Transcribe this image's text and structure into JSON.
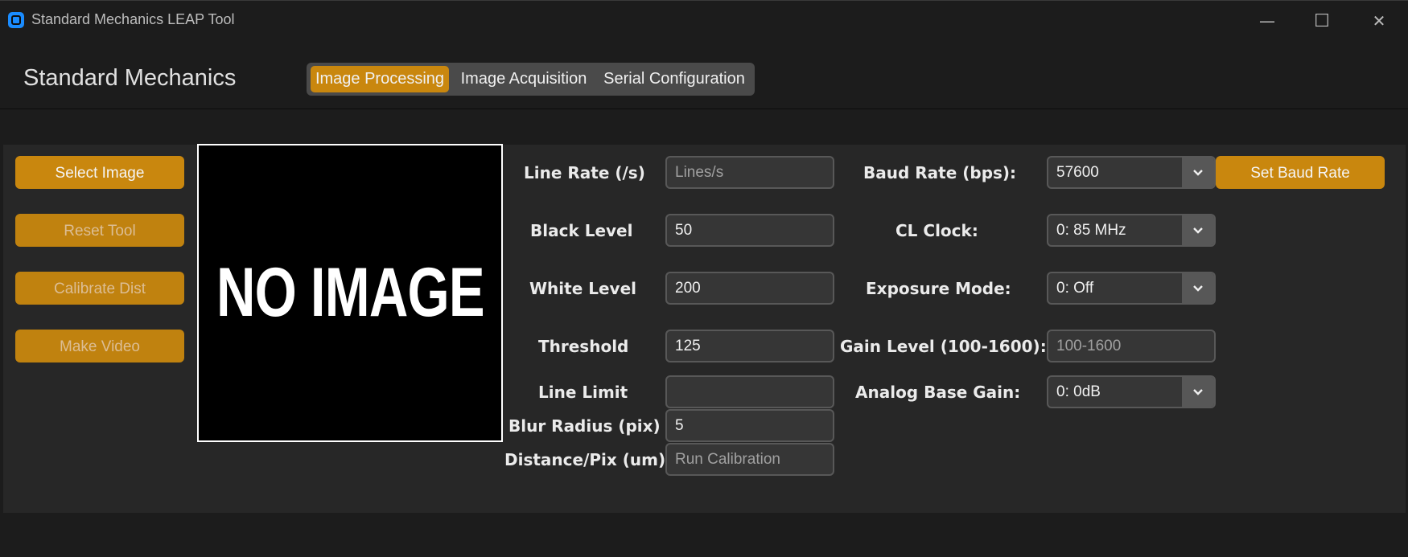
{
  "window": {
    "title": "Standard Mechanics LEAP Tool",
    "minimize": "—",
    "maximize": "☐",
    "close": "✕"
  },
  "header": {
    "brand": "Standard Mechanics",
    "tabs": [
      {
        "label": "Image Processing",
        "active": true
      },
      {
        "label": "Image Acquisition",
        "active": false
      },
      {
        "label": "Serial Configuration",
        "active": false
      }
    ]
  },
  "sidebar": {
    "buttons": [
      {
        "label": "Select Image",
        "enabled": true
      },
      {
        "label": "Reset Tool",
        "enabled": false
      },
      {
        "label": "Calibrate Dist",
        "enabled": false
      },
      {
        "label": "Make Video",
        "enabled": false
      }
    ]
  },
  "image": {
    "placeholder_text": "NO IMAGE"
  },
  "processing": {
    "line_rate": {
      "label": "Line Rate (/s)",
      "value": "",
      "placeholder": "Lines/s"
    },
    "black_level": {
      "label": "Black Level",
      "value": "50"
    },
    "white_level": {
      "label": "White Level",
      "value": "200"
    },
    "threshold": {
      "label": "Threshold",
      "value": "125"
    },
    "line_limit": {
      "label": "Line Limit",
      "value": ""
    },
    "blur_radius": {
      "label": "Blur Radius (pix)",
      "value": "5"
    },
    "distance_pix": {
      "label": "Distance/Pix (um)",
      "value": "",
      "placeholder": "Run Calibration"
    }
  },
  "camera": {
    "baud_rate": {
      "label": "Baud Rate (bps):",
      "value": "57600"
    },
    "cl_clock": {
      "label": "CL Clock:",
      "value": "0: 85 MHz"
    },
    "exposure_mode": {
      "label": "Exposure Mode:",
      "value": "0: Off"
    },
    "gain_level": {
      "label": "Gain Level (100-1600):",
      "value": "",
      "placeholder": "100-1600"
    },
    "analog_base_gain": {
      "label": "Analog Base Gain:",
      "value": "0: 0dB"
    },
    "set_baud_label": "Set Baud Rate"
  },
  "colors": {
    "accent": "#c9870e",
    "background": "#1c1c1c",
    "panel": "#272727",
    "field": "#363636"
  }
}
